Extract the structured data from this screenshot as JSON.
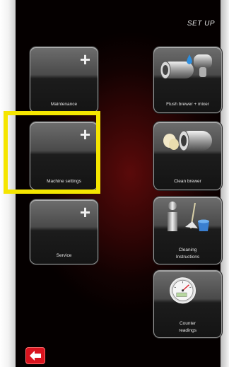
{
  "header": {
    "title": "SET UP"
  },
  "left_tiles": [
    {
      "label": "Maintenance",
      "icon": "plus-icon"
    },
    {
      "label": "Machine settings",
      "icon": "plus-icon"
    },
    {
      "label": "Service",
      "icon": "plus-icon"
    }
  ],
  "right_tiles": [
    {
      "label": "Flush brewer + mixer",
      "icon": "flush-brewer-icon"
    },
    {
      "label": "Clean brewer",
      "icon": "clean-brewer-icon"
    },
    {
      "label_line1": "Cleaning",
      "label_line2": "Instructions",
      "icon": "cleaning-instructions-icon"
    },
    {
      "label_line1": "Counter",
      "label_line2": "readings",
      "icon": "counter-readings-icon"
    }
  ],
  "back_button": {
    "icon": "arrow-left-icon"
  },
  "colors": {
    "highlight": "#f5e500",
    "back_button": "#d9141f",
    "background": "#3a0707"
  },
  "plus_glyph": "+"
}
